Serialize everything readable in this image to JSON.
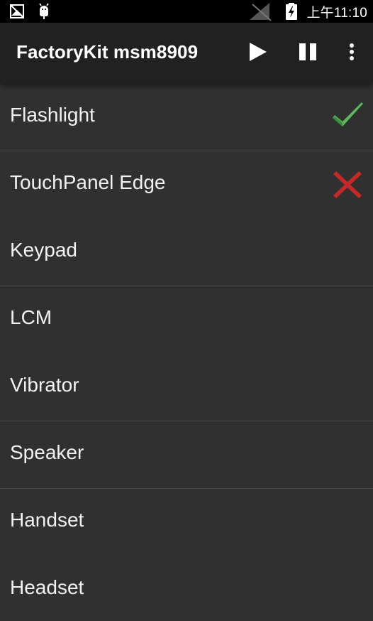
{
  "status_bar": {
    "left_icons": [
      "notification-image-icon",
      "android-debug-icon"
    ],
    "right_icons": [
      "signal-no-sim-icon",
      "battery-charging-icon"
    ],
    "time": "上午11:10"
  },
  "app_bar": {
    "title": "FactoryKit msm8909",
    "actions": [
      "play-icon",
      "pause-icon",
      "overflow-menu-icon"
    ]
  },
  "colors": {
    "pass": "#4caf50",
    "fail": "#d32f2f",
    "background": "#303030",
    "app_bar": "#212121"
  },
  "items": [
    {
      "label": "Flashlight",
      "status": "pass"
    },
    {
      "label": "TouchPanel Edge",
      "status": "fail"
    },
    {
      "label": "Keypad",
      "status": ""
    },
    {
      "label": "LCM",
      "status": ""
    },
    {
      "label": "Vibrator",
      "status": ""
    },
    {
      "label": "Speaker",
      "status": ""
    },
    {
      "label": "Handset",
      "status": ""
    },
    {
      "label": "Headset",
      "status": ""
    }
  ]
}
